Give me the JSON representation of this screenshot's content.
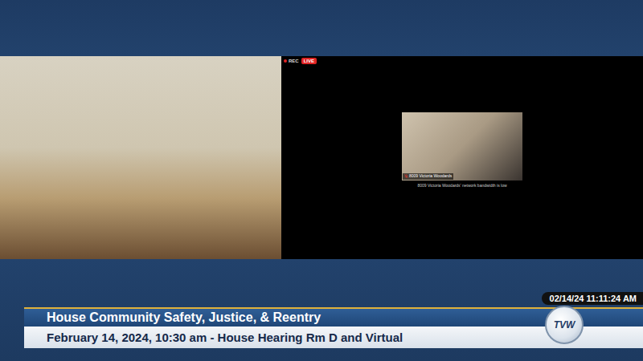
{
  "broadcast": {
    "title": "House Community Safety, Justice, & Reentry",
    "subtitle": "February 14, 2024, 10:30 am - House Hearing Rm D and Virtual",
    "timestamp": "02/14/24 11:11:24 AM",
    "logo": "TVW"
  },
  "meeting": {
    "recording": "REC",
    "live": "LIVE",
    "participant": {
      "name": "8009 Victoria Woodards",
      "muted": true,
      "notice": "8009 Victoria Woodards' network bandwidth is low"
    }
  }
}
